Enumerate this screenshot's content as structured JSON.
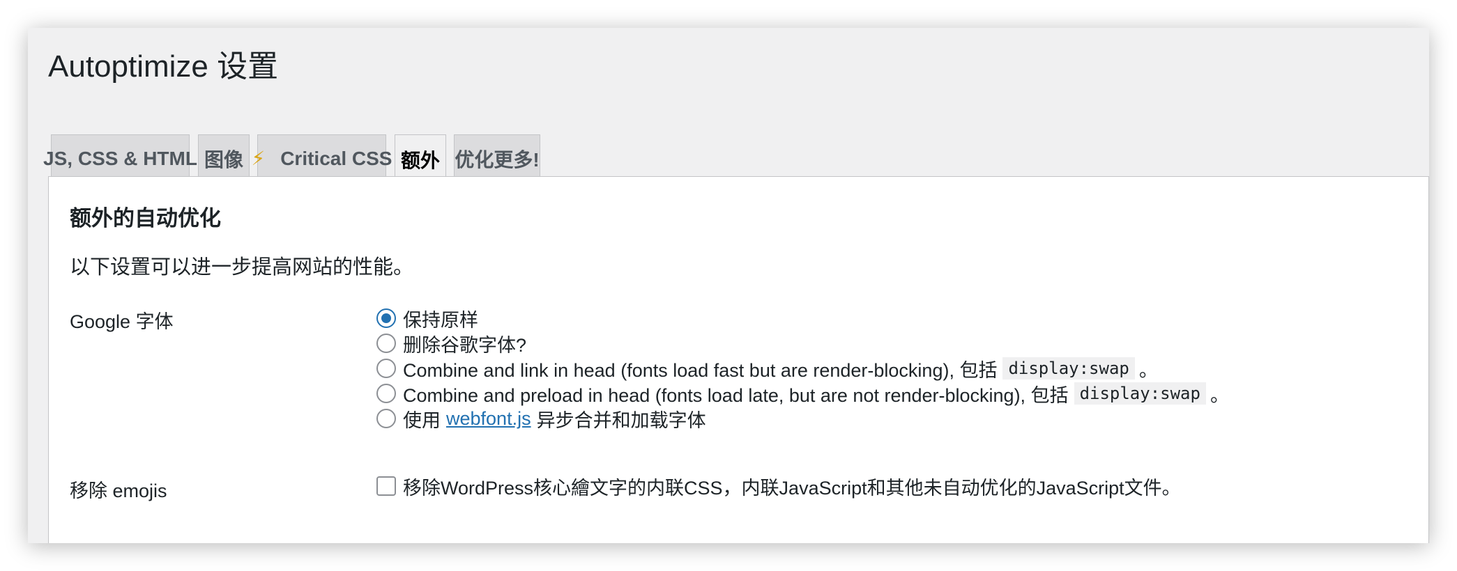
{
  "page": {
    "title": "Autoptimize 设置"
  },
  "tabs": [
    {
      "label": "JS, CSS & HTML"
    },
    {
      "label": "图像"
    },
    {
      "label": "Critical CSS",
      "icon": "lightning-bolt-icon",
      "icon_glyph": "⚡"
    },
    {
      "label": "额外",
      "active": true
    },
    {
      "label": "优化更多!"
    }
  ],
  "section": {
    "title": "额外的自动优化",
    "description": "以下设置可以进一步提高网站的性能。"
  },
  "google_fonts": {
    "label": "Google 字体",
    "selected_index": 0,
    "options": [
      {
        "label": "保持原样"
      },
      {
        "label": "删除谷歌字体?"
      },
      {
        "label": "Combine and link in head (fonts load fast but are render-blocking), 包括",
        "code": "display:swap",
        "suffix": "。"
      },
      {
        "label": "Combine and preload in head (fonts load late, but are not render-blocking), 包括",
        "code": "display:swap",
        "suffix": "。"
      },
      {
        "prefix": "使用",
        "link": "webfont.js",
        "label": "异步合并和加载字体"
      }
    ]
  },
  "emojis": {
    "label": "移除 emojis",
    "checked": false,
    "checkbox_label": "移除WordPress核心繪文字的内联CSS，内联JavaScript和其他未自动优化的JavaScript文件。"
  },
  "colors": {
    "accent": "#2271b1",
    "tab_bg": "#dcdcde",
    "page_bg": "#f0f0f1",
    "bolt": "#dba617"
  }
}
